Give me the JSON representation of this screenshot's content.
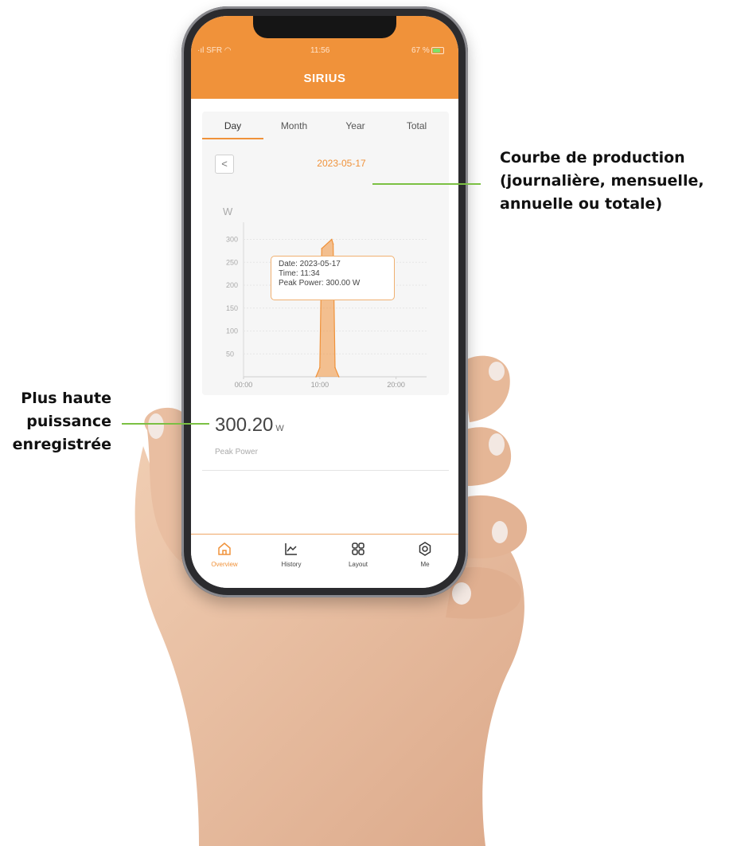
{
  "status": {
    "carrier": "SFR",
    "time": "11:56",
    "battery": "67 %"
  },
  "app": {
    "title": "SIRIUS"
  },
  "tabs": [
    "Day",
    "Month",
    "Year",
    "Total"
  ],
  "date_nav": {
    "prev": "<",
    "date": "2023-05-17"
  },
  "chart_data": {
    "type": "area",
    "ylabel": "W",
    "yticks": [
      "50",
      "100",
      "150",
      "200",
      "250",
      "300"
    ],
    "xticks": [
      "00:00",
      "10:00",
      "20:00"
    ],
    "ylim": [
      0,
      320
    ],
    "x": [
      "09:30",
      "10:00",
      "10:15",
      "11:34",
      "11:45",
      "12:00",
      "12:30"
    ],
    "values": [
      0,
      20,
      280,
      300,
      290,
      20,
      0
    ],
    "color": "#f0923a",
    "tooltip": {
      "date": "Date: 2023-05-17",
      "time": "Time: 11:34",
      "peak": "Peak Power: 300.00  W"
    }
  },
  "peak": {
    "value": "300.20",
    "unit": "W",
    "label": "Peak Power"
  },
  "nav": [
    {
      "label": "Overview",
      "icon": "home-icon",
      "active": true
    },
    {
      "label": "History",
      "icon": "chart-icon",
      "active": false
    },
    {
      "label": "Layout",
      "icon": "grid-icon",
      "active": false
    },
    {
      "label": "Me",
      "icon": "gear-icon",
      "active": false
    }
  ],
  "annotations": {
    "right": [
      "Courbe de production",
      "(journalière, mensuelle,",
      "annuelle ou totale)"
    ],
    "left": [
      "Plus haute",
      "puissance",
      "enregistrée"
    ]
  },
  "colors": {
    "accent": "#f0923a",
    "line": "#7bc043"
  }
}
